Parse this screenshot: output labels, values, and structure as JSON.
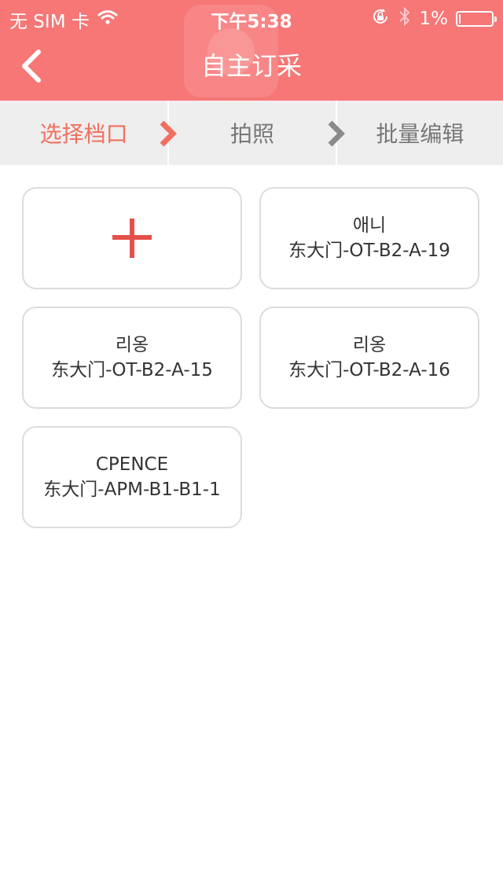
{
  "status_bar": {
    "carrier": "无 SIM 卡",
    "time": "下午5:38",
    "battery": "1%",
    "battery_level": 0.01
  },
  "nav": {
    "title": "自主订采"
  },
  "steps": [
    {
      "label": "选择档口",
      "active": true
    },
    {
      "label": "拍照",
      "active": false
    },
    {
      "label": "批量编辑",
      "active": false
    }
  ],
  "stalls": [
    {
      "name": "애니",
      "code": "东大门-OT-B2-A-19"
    },
    {
      "name": "리옹",
      "code": "东大门-OT-B2-A-15"
    },
    {
      "name": "리옹",
      "code": "东大门-OT-B2-A-16"
    },
    {
      "name": "CPENCE",
      "code": "东大门-APM-B1-B1-1"
    }
  ],
  "colors": {
    "accent": "#f77676",
    "active_step": "#f0705f",
    "plus": "#e5504a"
  }
}
